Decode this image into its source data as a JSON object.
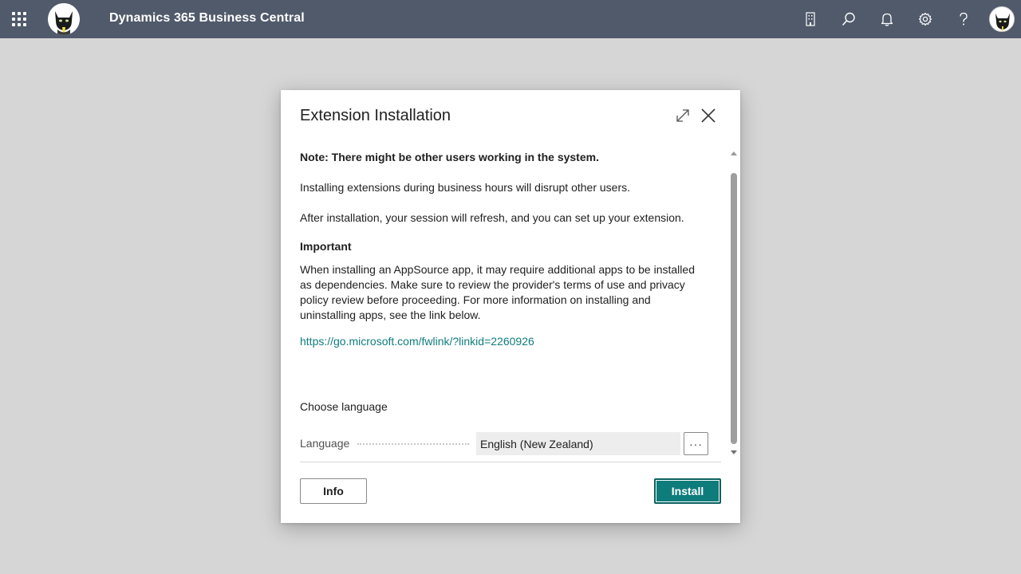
{
  "topbar": {
    "app_title": "Dynamics 365 Business Central",
    "icons": [
      "app-launcher-icon",
      "company-logo",
      "building-icon",
      "search-icon",
      "bell-icon",
      "gear-icon",
      "help-icon",
      "user-avatar"
    ]
  },
  "dialog": {
    "title": "Extension Installation",
    "note": "Note: There might be other users working in the system.",
    "paragraph1": "Installing extensions during business hours will disrupt other users.",
    "paragraph2": "After installation, your session will refresh, and you can set up your extension.",
    "important_heading": "Important",
    "important_body": "When installing an AppSource app, it may require additional apps to be installed as dependencies. Make sure to review the provider's terms of use and privacy policy review before proceeding. For more information on installing and uninstalling apps, see the link below.",
    "link": "https://go.microsoft.com/fwlink/?linkid=2260926",
    "choose_language": "Choose language",
    "language_label": "Language",
    "language_value": "English (New Zealand)",
    "more_button": "···",
    "info_button": "Info",
    "install_button": "Install"
  },
  "colors": {
    "topbar": "#505a6b",
    "accent": "#0f7c7c",
    "backdrop": "#d6d6d6"
  }
}
